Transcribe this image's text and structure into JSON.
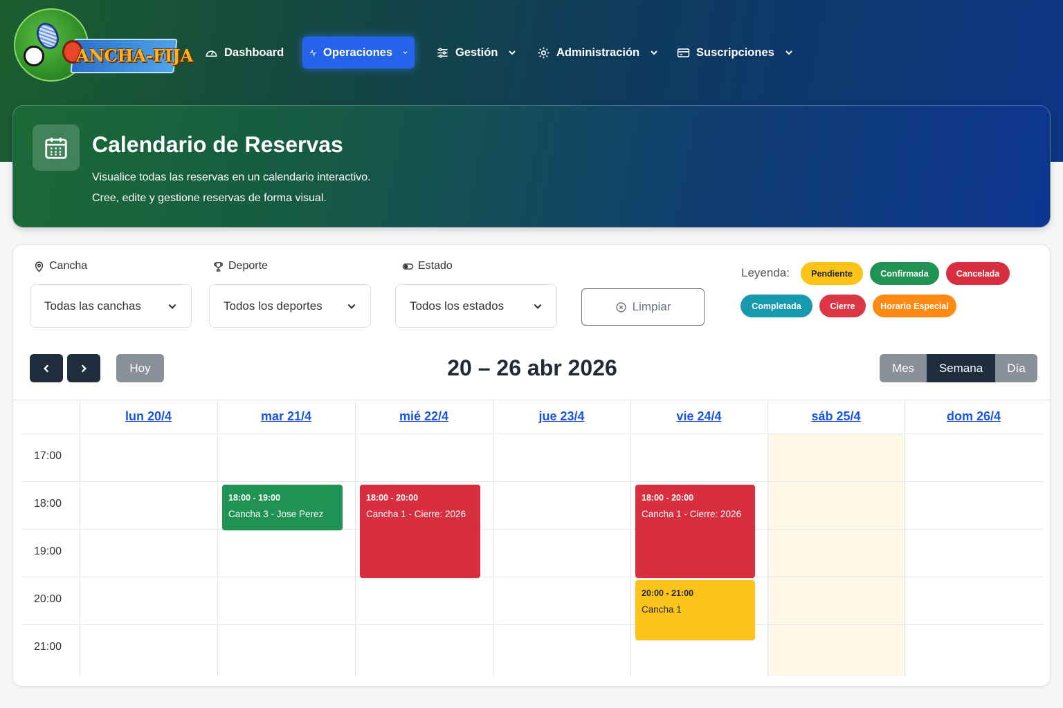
{
  "app": {
    "logo_text": "ANCHA-FIJA"
  },
  "nav": {
    "items": [
      {
        "label": "Dashboard",
        "icon": "gauge-icon"
      },
      {
        "label": "Operaciones",
        "icon": "activity-icon",
        "active": true
      },
      {
        "label": "Gestión",
        "icon": "sliders-icon"
      },
      {
        "label": "Administración",
        "icon": "gear-icon"
      },
      {
        "label": "Suscripciones",
        "icon": "card-icon"
      }
    ]
  },
  "hero": {
    "title": "Calendario de Reservas",
    "line1": "Visualice todas las reservas en un calendario interactivo.",
    "line2": "Cree, edite y gestione reservas de forma visual."
  },
  "filters": {
    "cancha": {
      "label": "Cancha",
      "value": "Todas las canchas"
    },
    "deporte": {
      "label": "Deporte",
      "value": "Todos los deportes"
    },
    "estado": {
      "label": "Estado",
      "value": "Todos los estados"
    },
    "clear_label": "Limpiar"
  },
  "legend": {
    "label": "Leyenda:",
    "items": [
      {
        "label": "Pendiente",
        "color": "#fcc419",
        "text": "#1f2937"
      },
      {
        "label": "Confirmada",
        "color": "#1f9254",
        "text": "#ffffff"
      },
      {
        "label": "Cancelada",
        "color": "#d72f3f",
        "text": "#ffffff"
      },
      {
        "label": "Completada",
        "color": "#179aad",
        "text": "#ffffff"
      },
      {
        "label": "Cierre",
        "color": "#dc3545",
        "text": "#ffffff"
      },
      {
        "label": "Horario Especial",
        "color": "#fd8a14",
        "text": "#ffffff"
      }
    ]
  },
  "toolbar": {
    "today_label": "Hoy",
    "range_title": "20 – 26 abr 2026",
    "views": [
      "Mes",
      "Semana",
      "Día"
    ],
    "active_view": "Semana"
  },
  "calendar": {
    "days": [
      "lun 20/4",
      "mar 21/4",
      "mié 22/4",
      "jue 23/4",
      "vie 24/4",
      "sáb 25/4",
      "dom 26/4"
    ],
    "hours": [
      "17:00",
      "18:00",
      "19:00",
      "20:00",
      "21:00"
    ],
    "today_index": 5,
    "events": [
      {
        "day": 1,
        "start": 18,
        "end": 19,
        "time": "18:00 - 19:00",
        "title": "Cancha 3 - Jose Perez",
        "color": "#1f9254",
        "text": "#ffffff"
      },
      {
        "day": 2,
        "start": 18,
        "end": 20,
        "time": "18:00 - 20:00",
        "title": "Cancha 1 - Cierre: 2026",
        "color": "#d72f3f",
        "text": "#ffffff"
      },
      {
        "day": 4,
        "start": 18,
        "end": 20,
        "time": "18:00 - 20:00",
        "title": "Cancha 1 - Cierre: 2026",
        "color": "#d72f3f",
        "text": "#ffffff"
      },
      {
        "day": 4,
        "start": 20,
        "end": 21.3,
        "time": "20:00 - 21:00",
        "title": "Cancha 1",
        "color": "#fcc419",
        "text": "#1f2937"
      }
    ]
  }
}
